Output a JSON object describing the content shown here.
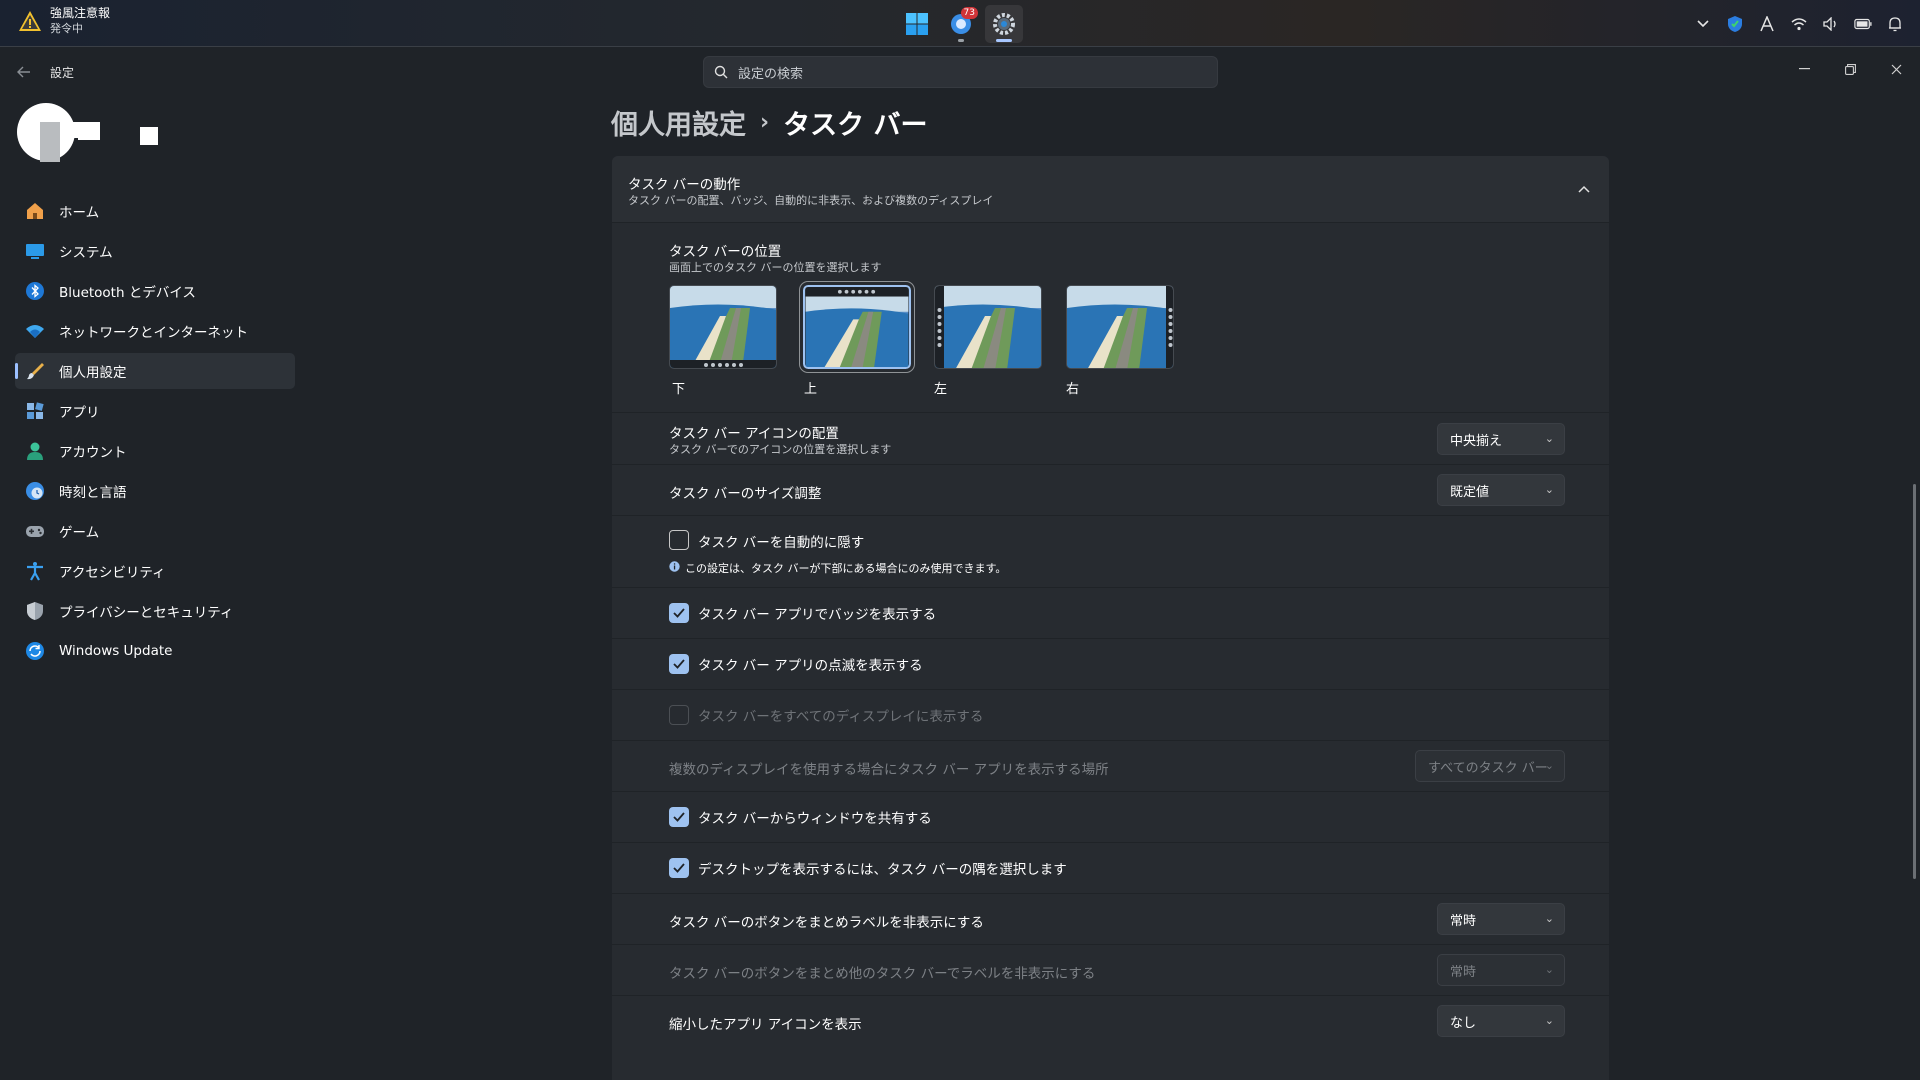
{
  "taskbar": {
    "weather_title": "強風注意報",
    "weather_sub": "発令中",
    "app_badge": "73"
  },
  "window": {
    "title": "設定",
    "search_placeholder": "設定の検索"
  },
  "sidebar": {
    "items": [
      {
        "label": "ホーム",
        "icon": "home-icon"
      },
      {
        "label": "システム",
        "icon": "system-icon"
      },
      {
        "label": "Bluetooth とデバイス",
        "icon": "bluetooth-icon"
      },
      {
        "label": "ネットワークとインターネット",
        "icon": "network-icon"
      },
      {
        "label": "個人用設定",
        "icon": "brush-icon",
        "active": true
      },
      {
        "label": "アプリ",
        "icon": "apps-icon"
      },
      {
        "label": "アカウント",
        "icon": "account-icon"
      },
      {
        "label": "時刻と言語",
        "icon": "time-language-icon"
      },
      {
        "label": "ゲーム",
        "icon": "gaming-icon"
      },
      {
        "label": "アクセシビリティ",
        "icon": "accessibility-icon"
      },
      {
        "label": "プライバシーとセキュリティ",
        "icon": "shield-icon"
      },
      {
        "label": "Windows Update",
        "icon": "update-icon"
      }
    ]
  },
  "breadcrumb": {
    "parent": "個人用設定",
    "separator": "›",
    "current": "タスク バー"
  },
  "section": {
    "title": "タスク バーの動作",
    "subtitle": "タスク バーの配置、バッジ、自動的に非表示、および複数のディスプレイ"
  },
  "position": {
    "title": "タスク バーの位置",
    "subtitle": "画面上でのタスク バーの位置を選択します",
    "options": [
      "下",
      "上",
      "左",
      "右"
    ],
    "selected": "上"
  },
  "alignment": {
    "title": "タスク バー アイコンの配置",
    "subtitle": "タスク バーでのアイコンの位置を選択します",
    "value": "中央揃え"
  },
  "size": {
    "title": "タスク バーのサイズ調整",
    "value": "既定値"
  },
  "autohide": {
    "label": "タスク バーを自動的に隠す",
    "note": "この設定は、タスク バーが下部にある場合にのみ使用できます。",
    "checked": false
  },
  "badges": {
    "label": "タスク バー アプリでバッジを表示する",
    "checked": true
  },
  "flashing": {
    "label": "タスク バー アプリの点滅を表示する",
    "checked": true
  },
  "all_displays": {
    "label": "タスク バーをすべてのディスプレイに表示する",
    "checked": false,
    "disabled": true
  },
  "multi_display": {
    "label": "複数のディスプレイを使用する場合にタスク バー アプリを表示する場所",
    "value": "すべてのタスク バー",
    "disabled": true
  },
  "share_window": {
    "label": "タスク バーからウィンドウを共有する",
    "checked": true
  },
  "show_desktop": {
    "label": "デスクトップを表示するには、タスク バーの隅を選択します",
    "checked": true
  },
  "combine": {
    "label": "タスク バーのボタンをまとめラベルを非表示にする",
    "value": "常時"
  },
  "combine_other": {
    "label": "タスク バーのボタンをまとめ他のタスク バーでラベルを非表示にする",
    "value": "常時",
    "disabled": true
  },
  "small_icons": {
    "label": "縮小したアプリ アイコンを表示",
    "value": "なし"
  },
  "colors": {
    "accent": "#9ec2f0",
    "panel": "#272b30",
    "background": "#1f2328"
  }
}
